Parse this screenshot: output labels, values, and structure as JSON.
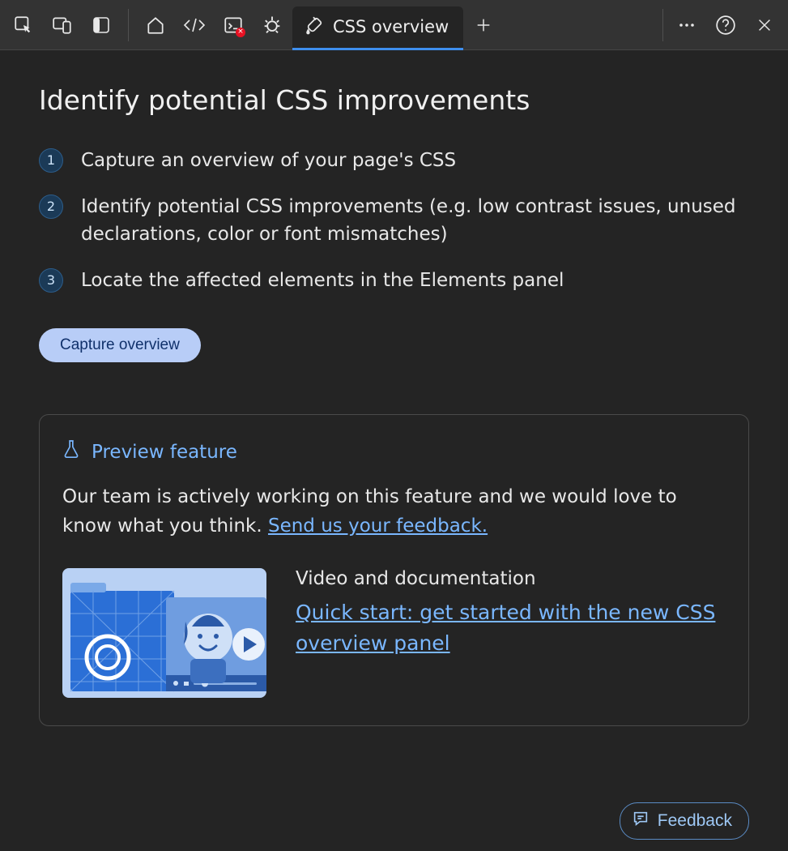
{
  "toolbar": {
    "active_tab": {
      "label": "CSS overview"
    }
  },
  "main": {
    "title": "Identify potential CSS improvements",
    "steps": [
      "Capture an overview of your page's CSS",
      "Identify potential CSS improvements (e.g. low contrast issues, unused declarations, color or font mismatches)",
      "Locate the affected elements in the Elements panel"
    ],
    "capture_button": "Capture overview"
  },
  "preview_card": {
    "header": "Preview feature",
    "body_prefix": "Our team is actively working on this feature and we would love to know what you think. ",
    "feedback_link": "Send us your feedback.",
    "doc_heading": "Video and documentation",
    "doc_link": "Quick start: get started with the new CSS overview panel"
  },
  "footer": {
    "feedback_button": "Feedback"
  }
}
